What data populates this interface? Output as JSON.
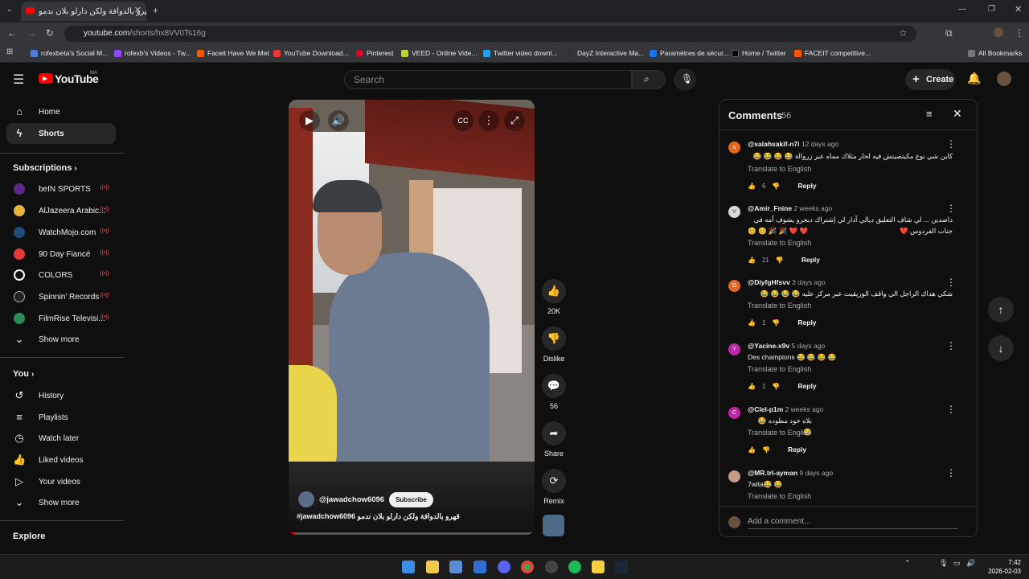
{
  "browser": {
    "tab_title": "قهرو بالدوافة ولكن دارلو بلان ندمو",
    "url_host": "youtube.com",
    "url_path": "/shorts/hx8VV0Ts16g",
    "bookmarks": [
      "rofexbeta's Social M...",
      "rofexb's Videos - Tw...",
      "Faceit Have We Met",
      "YouTube Download...",
      "Pinterest",
      "VEED - Online Vide...",
      "Twitter video downl...",
      "DayZ Interactive Ma...",
      "Paramètres de sécur...",
      "Home / Twitter",
      "FACEIT competitive..."
    ],
    "all_bookmarks": "All Bookmarks"
  },
  "header": {
    "logo": "YouTube",
    "logo_region": "MA",
    "search_placeholder": "Search",
    "create_label": "Create"
  },
  "sidebar": {
    "main": [
      {
        "label": "Home",
        "icon": "home-icon"
      },
      {
        "label": "Shorts",
        "icon": "shorts-icon",
        "active": true
      }
    ],
    "subscriptions_title": "Subscriptions",
    "subscriptions": [
      {
        "label": "beIN SPORTS",
        "color": "#5b2a86"
      },
      {
        "label": "AlJazeera Arabic...",
        "color": "#e8b33b"
      },
      {
        "label": "WatchMojo.com",
        "color": "#1f4d7a"
      },
      {
        "label": "90 Day Fiancé",
        "color": "#e53935"
      },
      {
        "label": "COLORS",
        "color": "#111111"
      },
      {
        "label": "Spinnin' Records",
        "color": "#222222"
      },
      {
        "label": "FilmRise Televisi...",
        "color": "#2e8b57"
      }
    ],
    "show_more": "Show more",
    "you_title": "You",
    "you_items": [
      {
        "label": "History",
        "icon": "history-icon"
      },
      {
        "label": "Playlists",
        "icon": "playlists-icon"
      },
      {
        "label": "Watch later",
        "icon": "watch-later-icon"
      },
      {
        "label": "Liked videos",
        "icon": "liked-videos-icon"
      },
      {
        "label": "Your videos",
        "icon": "your-videos-icon"
      }
    ],
    "show_more_2": "Show more",
    "explore_title": "Explore"
  },
  "video": {
    "channel": "@jawadchow6096",
    "subscribe_label": "Subscribe",
    "title": "#jawadchow6096 قهرو بالدوافة ولكن دارلو بلان ندمو",
    "progress": 0.03
  },
  "actions": {
    "likes": "20K",
    "dislike_label": "Dislike",
    "comments": "56",
    "share_label": "Share",
    "remix_label": "Remix"
  },
  "comments_panel": {
    "title": "Comments",
    "count": "56",
    "translate": "Translate to English",
    "reply": "Reply",
    "add_placeholder": "Add a comment...",
    "items": [
      {
        "initial": "s",
        "color": "#e0691f",
        "user": "@salahsakif-n7i",
        "time": "12 days ago",
        "text": "كاين شي نوع مكيتصيتش فيه لحار مثلاك مماه عبر زروالة 😂 😂 😂 😂",
        "likes": "6"
      },
      {
        "initial": "V",
        "color": "#d9d9d9",
        "user": "@Amir_Fnine",
        "time": "2 weeks ago",
        "text": "داصدين ... لي شاف التعليق ديالي آدار لي إشتراك دبجرو يشوف أمه في جنات الفردوس ❤️",
        "text2": "😊 😊 🎉 🎉 ❤️ ❤️",
        "likes": "21"
      },
      {
        "initial": "D",
        "color": "#e0691f",
        "user": "@DiyfgHfsvv",
        "time": "3 days ago",
        "text": "شكي هداك الراجل الي واقف الوريقيت عبر مركز عليه 😂 😂 😂 😂",
        "likes": "1"
      },
      {
        "initial": "Y",
        "color": "#c026a8",
        "user": "@Yacine-x9v",
        "time": "5 days ago",
        "text": "Des champions 😂 😂 😂 😂",
        "ltr": true,
        "likes": "1"
      },
      {
        "initial": "C",
        "color": "#c026a8",
        "user": "@Clel-p1m",
        "time": "2 weeks ago",
        "text": "بلاه خود مطوده 😂 😂",
        "likes": ""
      },
      {
        "initial": "",
        "color": "#c79a8a",
        "user": "@MR.trl-ayman",
        "time": "9 days ago",
        "text": "7wita😂 😂",
        "ltr": true,
        "likes": ""
      }
    ]
  },
  "taskbar": {
    "time": "7:42",
    "date": "2026-02-03"
  }
}
